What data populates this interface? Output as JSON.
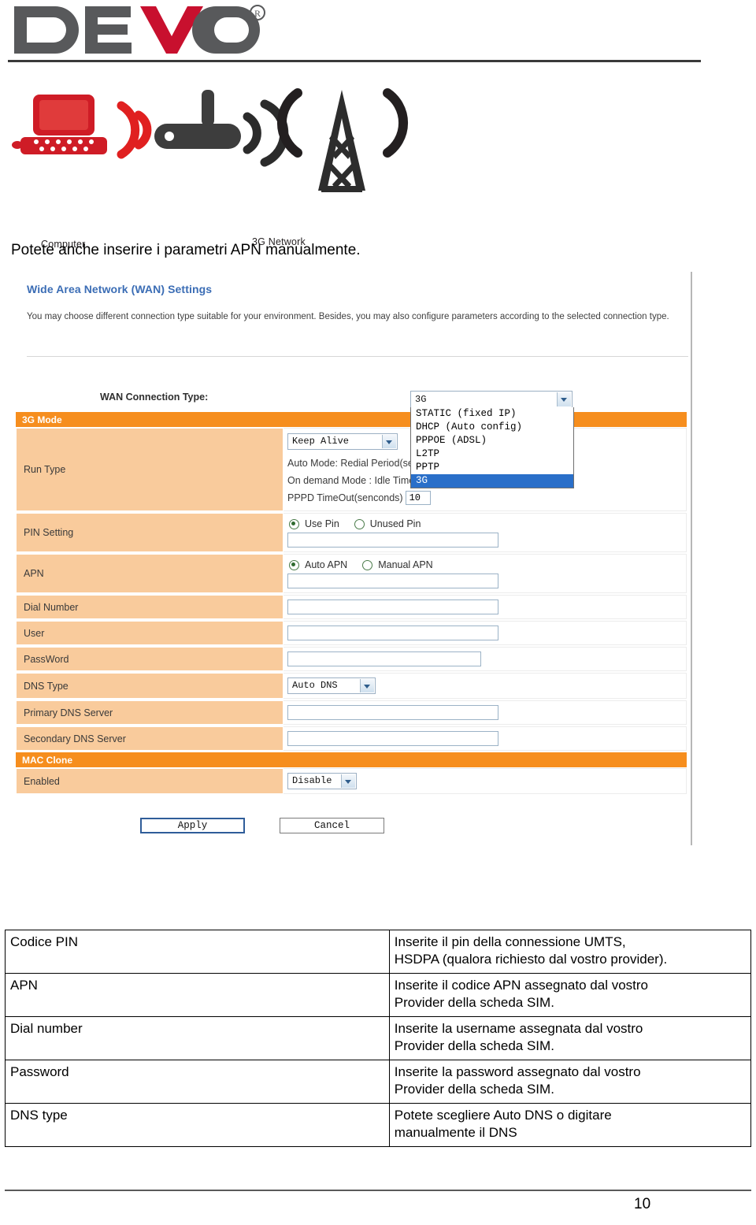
{
  "brand": {
    "name": "DEVO",
    "registered_mark": "®",
    "logo_gray": "#58595b",
    "logo_red": "#c8102e"
  },
  "hero": {
    "computer_label": "Computer",
    "network_label": "3G Network",
    "icons": [
      "laptop-icon",
      "wifi-waves-icon",
      "router-icon",
      "cell-tower-icon"
    ]
  },
  "intro_text": "Potete anche inserire i parametri APN manualmente.",
  "router_panel": {
    "title": "Wide Area Network (WAN) Settings",
    "description": "You may choose different connection type suitable for your environment. Besides, you may also configure parameters according to the selected connection type.",
    "wan_connection_type_label": "WAN Connection Type:",
    "wan_connection_type_value": "3G",
    "wan_options": [
      "STATIC (fixed IP)",
      "DHCP (Auto config)",
      "PPPOE (ADSL)",
      "L2TP",
      "PPTP",
      "3G"
    ],
    "wan_selected_option": "3G",
    "sections": {
      "mode_header": "3G Mode",
      "mac_clone_header": "MAC Clone"
    },
    "rows": {
      "run_type_label": "Run Type",
      "run_type_value": "Keep Alive",
      "run_type_options": [
        "Keep Alive"
      ],
      "auto_mode_label": "Auto Mode: Redial Period(seconds)",
      "auto_mode_value": "",
      "on_demand_label": "On demand Mode : Idle Time(minutes)",
      "on_demand_value": "",
      "pppd_timeout_label": "PPPD TimeOut(senconds)",
      "pppd_timeout_value": "10",
      "pin_setting_label": "PIN Setting",
      "pin_use_label": "Use Pin",
      "pin_unused_label": "Unused Pin",
      "pin_value": "",
      "apn_label": "APN",
      "apn_auto_label": "Auto APN",
      "apn_manual_label": "Manual APN",
      "apn_value": "",
      "dial_number_label": "Dial Number",
      "dial_number_value": "",
      "user_label": "User",
      "user_value": "",
      "password_label": "PassWord",
      "password_value": "",
      "dns_type_label": "DNS Type",
      "dns_type_value": "Auto DNS",
      "primary_dns_label": "Primary DNS Server",
      "primary_dns_value": "",
      "secondary_dns_label": "Secondary DNS Server",
      "secondary_dns_value": "",
      "enabled_label": "Enabled",
      "enabled_value": "Disable"
    },
    "buttons": {
      "apply": "Apply",
      "cancel": "Cancel"
    },
    "accent_orange": "#f68e1e",
    "row_orange": "#f9cb9c",
    "title_blue": "#3b6db5"
  },
  "description_table": [
    {
      "key": "Codice PIN",
      "lines": [
        "Inserite il pin della connessione UMTS,",
        "HSDPA (qualora richiesto dal vostro provider)."
      ]
    },
    {
      "key": "APN",
      "lines": [
        "Inserite il codice APN assegnato dal vostro",
        "Provider della scheda SIM."
      ]
    },
    {
      "key": "Dial number",
      "lines": [
        "Inserite la username assegnata dal vostro",
        "Provider della scheda SIM."
      ]
    },
    {
      "key": "Password",
      "lines": [
        "Inserite la password assegnato dal vostro",
        "Provider della scheda SIM."
      ]
    },
    {
      "key": "DNS type",
      "lines": [
        "Potete scegliere Auto DNS o digitare",
        "manualmente il DNS"
      ]
    }
  ],
  "page_number": "10"
}
